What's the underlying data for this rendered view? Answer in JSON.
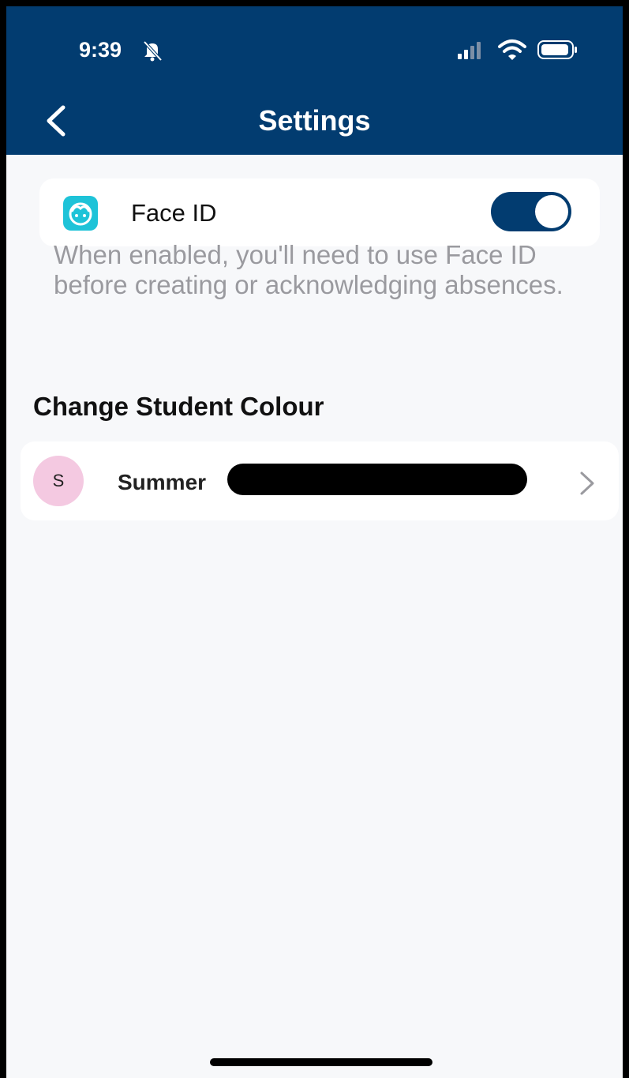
{
  "status_bar": {
    "time": "9:39",
    "icons": [
      "bell-slash-icon",
      "signal-icon",
      "wifi-icon",
      "battery-icon"
    ]
  },
  "header": {
    "title": "Settings",
    "back_icon": "chevron-left-icon",
    "background_color": "#023c70"
  },
  "face_id": {
    "label": "Face ID",
    "enabled": true,
    "description": "When enabled, you'll need to use Face ID before creating or acknowledging absences.",
    "icon": "face-icon",
    "icon_color": "#1ec3d8"
  },
  "student_colour": {
    "section_title": "Change Student Colour",
    "students": [
      {
        "initial": "S",
        "name": "Summer",
        "avatar_color": "#f4c9e1"
      }
    ]
  },
  "colors": {
    "accent": "#023c70",
    "background": "#f7f8fa"
  }
}
